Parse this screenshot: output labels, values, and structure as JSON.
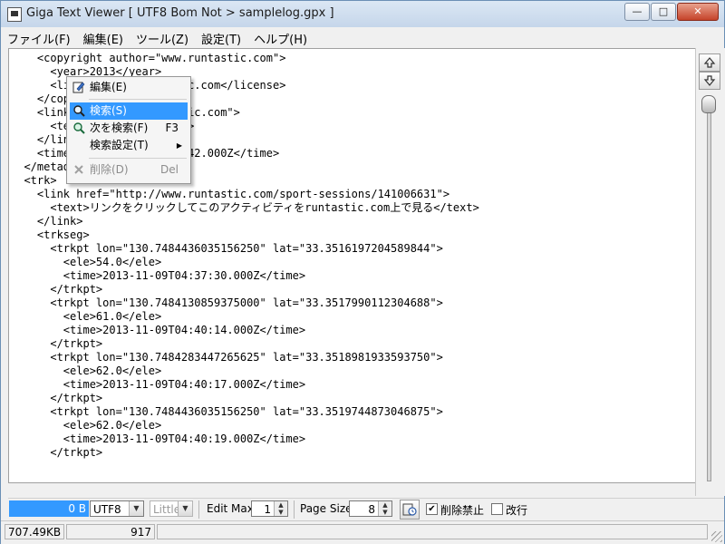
{
  "window": {
    "title": "Giga Text Viewer [ UTF8 Bom Not > samplelog.gpx ]",
    "controls": {
      "minimize": "—",
      "maximize": "□",
      "close": "✕"
    }
  },
  "menubar": {
    "items": [
      "ファイル(F)",
      "編集(E)",
      "ツール(Z)",
      "設定(T)",
      "ヘルプ(H)"
    ]
  },
  "editor": {
    "lines": [
      "    <copyright author=\"www.runtastic.com\">",
      "      <year>2013</year>",
      "      <license>www.runtastic.com</license>",
      "    </copyright>",
      "    <link href=\"www.runtastic.com\">",
      "      <text>runtastic</text>",
      "    </link>",
      "    <time>2013-11-09T04:35:42.000Z</time>",
      "  </metadata>",
      "  <trk>",
      "    <link href=\"http://www.runtastic.com/sport-sessions/141006631\">",
      "      <text>リンクをクリックしてこのアクティビティをruntastic.com上で見る</text>",
      "    </link>",
      "    <trkseg>",
      "      <trkpt lon=\"130.7484436035156250\" lat=\"33.3516197204589844\">",
      "        <ele>54.0</ele>",
      "        <time>2013-11-09T04:37:30.000Z</time>",
      "      </trkpt>",
      "      <trkpt lon=\"130.7484130859375000\" lat=\"33.3517990112304688\">",
      "        <ele>61.0</ele>",
      "        <time>2013-11-09T04:40:14.000Z</time>",
      "      </trkpt>",
      "      <trkpt lon=\"130.7484283447265625\" lat=\"33.3518981933593750\">",
      "        <ele>62.0</ele>",
      "        <time>2013-11-09T04:40:17.000Z</time>",
      "      </trkpt>",
      "      <trkpt lon=\"130.7484436035156250\" lat=\"33.3519744873046875\">",
      "        <ele>62.0</ele>",
      "        <time>2013-11-09T04:40:19.000Z</time>",
      "      </trkpt>"
    ]
  },
  "context_menu": {
    "items": [
      {
        "label": "編集(E)",
        "shortcut": "",
        "icon": "edit-icon",
        "state": "normal"
      },
      {
        "label": "検索(S)",
        "shortcut": "",
        "icon": "search-icon",
        "state": "selected"
      },
      {
        "label": "次を検索(F)",
        "shortcut": "F3",
        "icon": "find-next-icon",
        "state": "normal"
      },
      {
        "label": "検索設定(T)",
        "shortcut": "",
        "icon": "",
        "state": "submenu",
        "arrow": "▶"
      },
      {
        "label": "削除(D)",
        "shortcut": "Del",
        "icon": "delete-icon",
        "state": "disabled"
      }
    ]
  },
  "toolbar": {
    "size_readout": "0 B",
    "encoding": "UTF8",
    "endian": "Little",
    "edit_max_label": "Edit Max",
    "edit_max_value": "1",
    "page_size_label": "Page Size",
    "page_size_value": "8",
    "delete_lock_label": "削除禁止",
    "delete_lock_checked": true,
    "wrap_label": "改行",
    "wrap_checked": false,
    "check_mark": "✔"
  },
  "statusbar": {
    "file_size": "707.49KB",
    "line_count": "917"
  },
  "colors": {
    "selection": "#3399ff",
    "title_gradient_top": "#dbe7f4",
    "close_button": "#c5432a"
  }
}
